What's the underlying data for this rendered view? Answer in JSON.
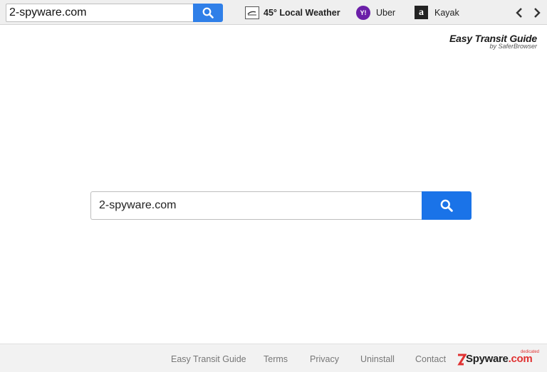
{
  "toolbar": {
    "search_value": "2-spyware.com",
    "weather_label": "45° Local Weather",
    "uber_label": "Uber",
    "kayak_label": "Kayak",
    "yahoo_icon_text": "Y!",
    "amazon_icon_text": "a"
  },
  "brand": {
    "title": "Easy Transit Guide",
    "subtitle": "by SaferBrowser"
  },
  "main": {
    "search_value": "2-spyware.com"
  },
  "footer": {
    "links": [
      "Easy Transit Guide",
      "Terms",
      "Privacy",
      "Uninstall",
      "Contact"
    ]
  },
  "watermark": {
    "text_a": "2",
    "text_b": "Spyware",
    "text_c": ".com",
    "badge": "dedicated"
  },
  "colors": {
    "accent_blue": "#1a73e8",
    "toolbar_blue": "#2f7fe8",
    "yahoo_purple": "#6b1fa8"
  }
}
